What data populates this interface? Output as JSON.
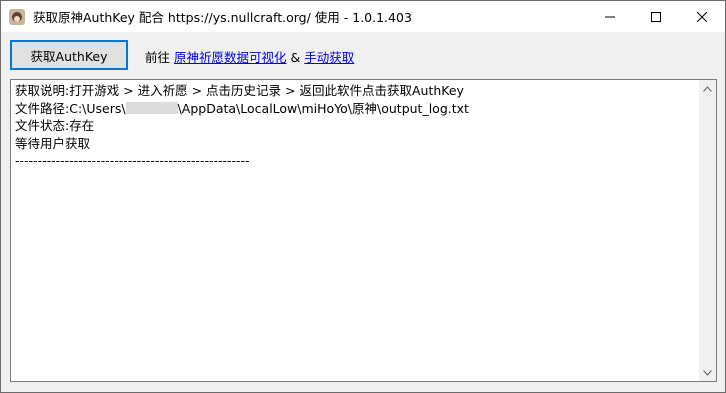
{
  "window": {
    "title": "获取原神AuthKey 配合 https://ys.nullcraft.org/ 使用 - 1.0.1.403",
    "icon": "app-icon"
  },
  "controls": {
    "minimize_icon": "minimize-icon",
    "maximize_icon": "maximize-icon",
    "close_icon": "close-icon"
  },
  "toolbar": {
    "get_button_label": "获取AuthKey",
    "go_prefix": "前往",
    "link_visualize": "原神祈愿数据可视化",
    "ampersand": "&",
    "link_manual": "手动获取"
  },
  "log": {
    "line1": "获取说明:打开游戏 > 进入祈愿 > 点击历史记录 > 返回此软件点击获取AuthKey",
    "line2_prefix": "文件路径:C:\\Users\\",
    "line2_suffix": "\\AppData\\LocalLow\\miHoYo\\原神\\output_log.txt",
    "line3": "文件状态:存在",
    "line4": "等待用户获取",
    "line5": "----------------------------------------------------"
  },
  "scrollbar": {
    "up_icon": "scroll-up-icon",
    "down_icon": "scroll-down-icon"
  }
}
